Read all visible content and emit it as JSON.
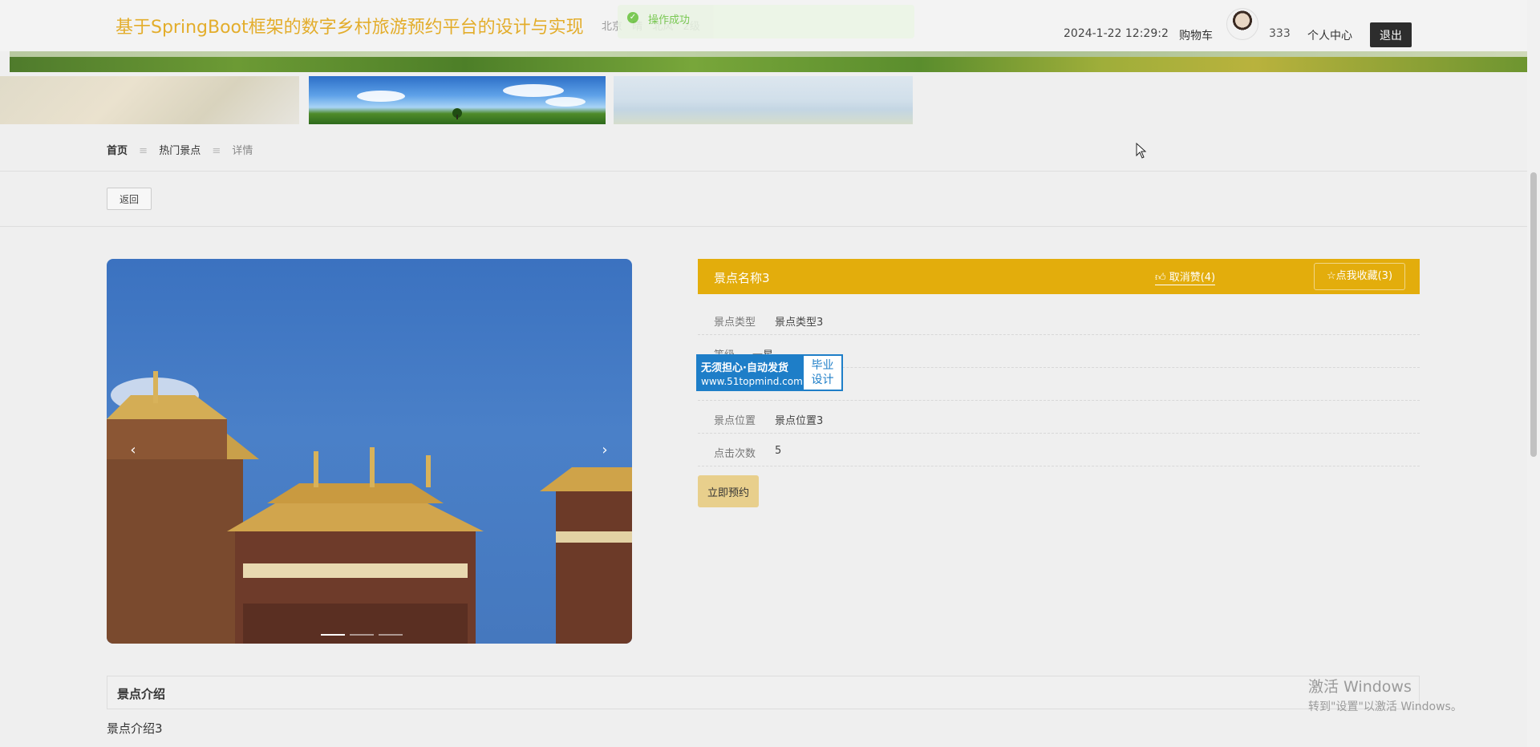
{
  "header": {
    "site_title": "基于SpringBoot框架的数字乡村旅游预约平台的设计与实现",
    "weather": {
      "city": "北京",
      "cond": "晴",
      "wind": "北风",
      "level": "2级"
    },
    "toast": "操作成功",
    "datetime": "2024-1-22 12:29:2",
    "cart": "购物车",
    "username": "333",
    "profile": "个人中心",
    "logout": "退出"
  },
  "breadcrumb": {
    "home": "首页",
    "section": "热门景点",
    "current": "详情"
  },
  "back_label": "返回",
  "detail": {
    "title": "景点名称3",
    "like_label": "取消赞(4)",
    "fav_label": "点我收藏(3)",
    "rows": [
      {
        "label": "景点类型",
        "value": "景点类型3"
      },
      {
        "label": "等级",
        "value": "一星"
      },
      {
        "label": "",
        "value": ""
      },
      {
        "label": "景点位置",
        "value": "景点位置3"
      },
      {
        "label": "点击次数",
        "value": "5"
      }
    ],
    "book_label": "立即预约"
  },
  "badge": {
    "line1": "无须担心·自动发货",
    "line2": "www.51topmind.com",
    "right1": "毕业",
    "right2": "设计"
  },
  "intro": {
    "title": "景点介绍",
    "text": "景点介绍3"
  },
  "windows": {
    "line1": "激活 Windows",
    "line2": "转到\"设置\"以激活 Windows。"
  },
  "colors": {
    "accent": "#e3ad0c",
    "title": "#e3ad2b",
    "success": "#67c23a"
  },
  "icons": {
    "like": "thumb-up-icon",
    "fav": "star-icon",
    "success": "check-circle-icon"
  }
}
